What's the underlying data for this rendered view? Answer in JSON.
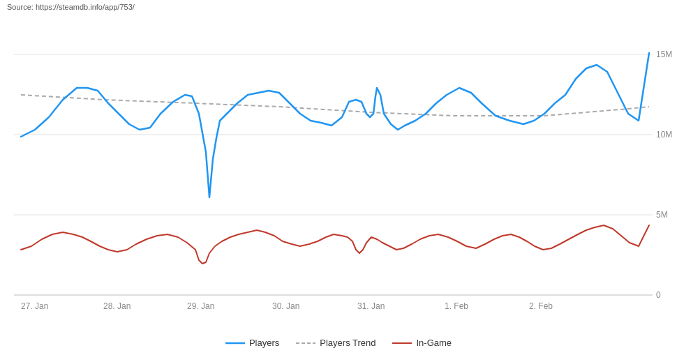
{
  "source": {
    "text": "Source: https://steamdb.info/app/753/"
  },
  "chart": {
    "y_labels": [
      "15M",
      "10M",
      "5M",
      "0"
    ],
    "x_labels": [
      "27. Jan",
      "28. Jan",
      "29. Jan",
      "30. Jan",
      "31. Jan",
      "1. Feb",
      "2. Feb",
      ""
    ],
    "grid_color": "#e0e0e0",
    "axis_color": "#ccc"
  },
  "legend": {
    "items": [
      {
        "label": "Players",
        "type": "solid",
        "color": "#2196f3"
      },
      {
        "label": "Players Trend",
        "type": "dashed",
        "color": "#aaaaaa"
      },
      {
        "label": "In-Game",
        "type": "solid",
        "color": "#c0392b"
      }
    ]
  }
}
